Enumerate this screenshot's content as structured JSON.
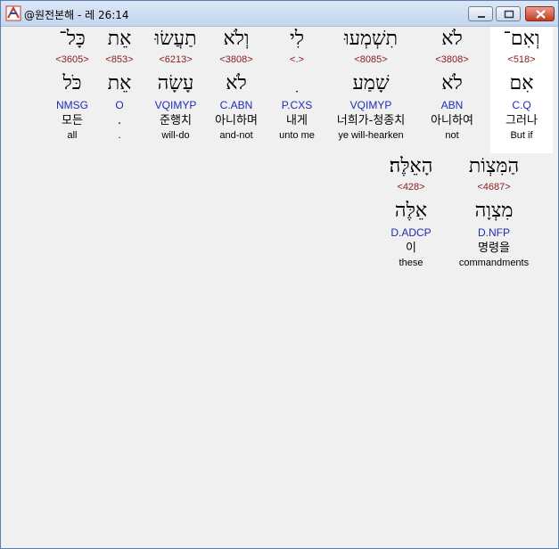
{
  "window": {
    "title": "@원전본해 - 레 26:14"
  },
  "words": [
    {
      "hebrew": "וְאִם־",
      "strong": "<518>",
      "lemma": "אִם",
      "morph": "C.Q",
      "korean": "그러나",
      "english": "But if",
      "highlighted": true
    },
    {
      "hebrew": "לֹא",
      "strong": "<3808>",
      "lemma": "לֹא",
      "morph": "ABN",
      "korean": "아니하여",
      "english": "not"
    },
    {
      "hebrew": "תִשְׁמְעוּ",
      "strong": "<8085>",
      "lemma": "שָׁמַע",
      "morph": "VQIMYP",
      "korean": "너희가-청종치",
      "english": "ye will-hearken"
    },
    {
      "hebrew": "לִי",
      "strong": "<.>",
      "lemma": "ִ",
      "morph": "P.CXS",
      "korean": "내게",
      "english": "unto me"
    },
    {
      "hebrew": "וְלֹא",
      "strong": "<3808>",
      "lemma": "לֹא",
      "morph": "C.ABN",
      "korean": "아니하며",
      "english": "and-not"
    },
    {
      "hebrew": "תַעֲשׂוּ",
      "strong": "<6213>",
      "lemma": "עָשָׂה",
      "morph": "VQIMYP",
      "korean": "준행치",
      "english": "will-do"
    },
    {
      "hebrew": "אֵת",
      "strong": "<853>",
      "lemma": "אֵת",
      "morph": "O",
      "korean": ".",
      "english": "."
    },
    {
      "hebrew": "כָּל־",
      "strong": "<3605>",
      "lemma": "כֹּל",
      "morph": "NMSG",
      "korean": "모든",
      "english": "all"
    },
    {
      "hebrew": "הַמִּצְוֹת",
      "strong": "<4687>",
      "lemma": "מִצְוָה",
      "morph": "D.NFP",
      "korean": "명령을",
      "english": "commandments"
    },
    {
      "hebrew": "הָאֵלֶּה׃",
      "strong": "<428>",
      "lemma": "אֵלֶּה",
      "morph": "D.ADCP",
      "korean": "이",
      "english": "these"
    }
  ]
}
